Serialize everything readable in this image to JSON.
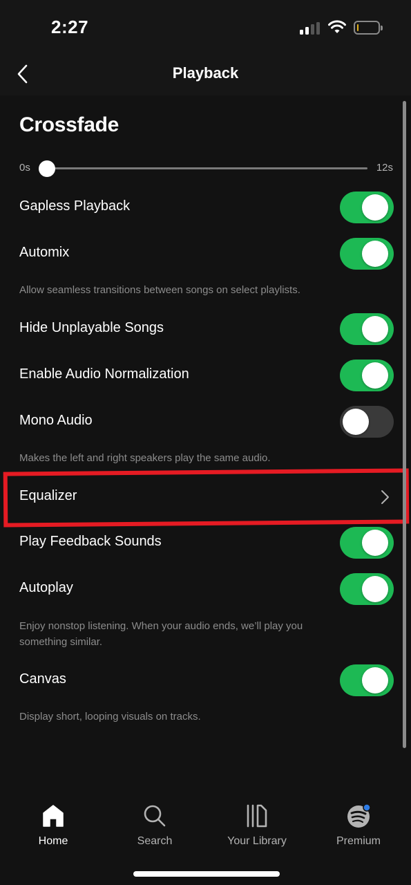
{
  "status_bar": {
    "time": "2:27",
    "signal_bars_active": 2,
    "signal_bars_total": 4,
    "battery_level_percent": 5,
    "battery_color": "#e3b21c"
  },
  "header": {
    "title": "Playback",
    "back_icon": "chevron-left-icon"
  },
  "crossfade": {
    "title": "Crossfade",
    "min_label": "0s",
    "max_label": "12s",
    "value_seconds": 0,
    "min_seconds": 0,
    "max_seconds": 12
  },
  "settings": [
    {
      "label": "Gapless Playback",
      "type": "toggle",
      "on": true
    },
    {
      "label": "Automix",
      "type": "toggle",
      "on": true,
      "description": "Allow seamless transitions between songs on select playlists."
    },
    {
      "label": "Hide Unplayable Songs",
      "type": "toggle",
      "on": true
    },
    {
      "label": "Enable Audio Normalization",
      "type": "toggle",
      "on": true
    },
    {
      "label": "Mono Audio",
      "type": "toggle",
      "on": false,
      "description": "Makes the left and right speakers play the same audio."
    },
    {
      "label": "Equalizer",
      "type": "link",
      "icon": "chevron-right-icon",
      "highlighted": true
    },
    {
      "label": "Play Feedback Sounds",
      "type": "toggle",
      "on": true
    },
    {
      "label": "Autoplay",
      "type": "toggle",
      "on": true,
      "description_line1": "Enjoy nonstop listening. When your audio ends, we’ll play you",
      "description_line2": "something similar."
    },
    {
      "label": "Canvas",
      "type": "toggle",
      "on": true,
      "description": "Display short, looping visuals on tracks."
    }
  ],
  "tabbar": {
    "tabs": [
      {
        "label": "Home",
        "icon": "home-icon",
        "active": true
      },
      {
        "label": "Search",
        "icon": "search-icon",
        "active": false
      },
      {
        "label": "Your Library",
        "icon": "library-icon",
        "active": false
      },
      {
        "label": "Premium",
        "icon": "spotify-logo-icon",
        "active": false,
        "badge_color": "#2d7be5"
      }
    ]
  },
  "colors": {
    "background": "#121212",
    "accent_green": "#1db954",
    "toggle_off": "#3a3a3a",
    "highlight_red": "#e51b23",
    "secondary_text": "#8c8c8c"
  }
}
